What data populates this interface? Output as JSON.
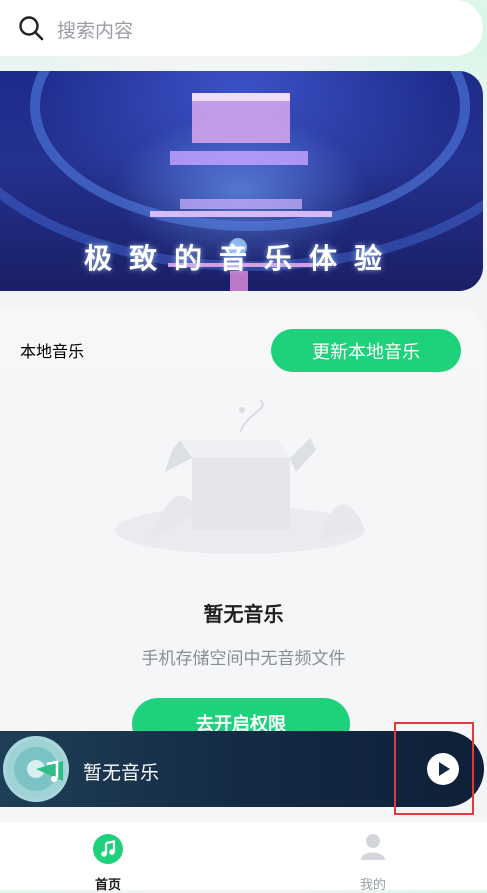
{
  "search": {
    "placeholder": "搜索内容"
  },
  "banner": {
    "title": "极致的音乐体验"
  },
  "local_music": {
    "heading": "本地音乐",
    "update_button": "更新本地音乐",
    "empty_title": "暂无音乐",
    "empty_subtitle": "手机存储空间中无音频文件",
    "permission_button": "去开启权限"
  },
  "player": {
    "song_title": "暂无音乐"
  },
  "nav": {
    "items": [
      {
        "label": "首页",
        "icon": "music-note-icon",
        "active": true
      },
      {
        "label": "我的",
        "icon": "user-icon",
        "active": false
      }
    ]
  },
  "colors": {
    "accent": "#1ed27c",
    "player_bg": "#142a44",
    "highlight": "#e03b3b"
  }
}
